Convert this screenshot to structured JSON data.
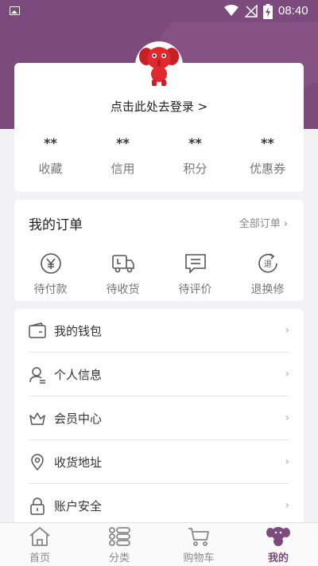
{
  "status_bar": {
    "time": "08:40"
  },
  "profile": {
    "login_prompt": "点击此处去登录 >",
    "stats": [
      {
        "value": "**",
        "label": "收藏"
      },
      {
        "value": "**",
        "label": "信用"
      },
      {
        "value": "**",
        "label": "积分"
      },
      {
        "value": "**",
        "label": "优惠券"
      }
    ]
  },
  "orders": {
    "title": "我的订单",
    "all_label": "全部订单",
    "items": [
      {
        "label": "待付款",
        "icon": "yen-icon"
      },
      {
        "label": "待收货",
        "icon": "truck-icon"
      },
      {
        "label": "待评价",
        "icon": "comment-icon"
      },
      {
        "label": "退换修",
        "icon": "return-icon"
      }
    ]
  },
  "menu": {
    "items": [
      {
        "label": "我的钱包",
        "icon": "wallet-icon"
      },
      {
        "label": "个人信息",
        "icon": "person-icon"
      },
      {
        "label": "会员中心",
        "icon": "crown-icon"
      },
      {
        "label": "收货地址",
        "icon": "location-icon"
      },
      {
        "label": "账户安全",
        "icon": "lock-icon"
      }
    ]
  },
  "tabbar": {
    "items": [
      {
        "label": "首页",
        "icon": "home-icon"
      },
      {
        "label": "分类",
        "icon": "category-icon"
      },
      {
        "label": "购物车",
        "icon": "cart-icon"
      },
      {
        "label": "我的",
        "icon": "mascot-icon",
        "active": true
      }
    ],
    "active_color": "#7d4a7d"
  },
  "colors": {
    "brand": "#7d4a7d",
    "mascot": "#d7262b"
  }
}
